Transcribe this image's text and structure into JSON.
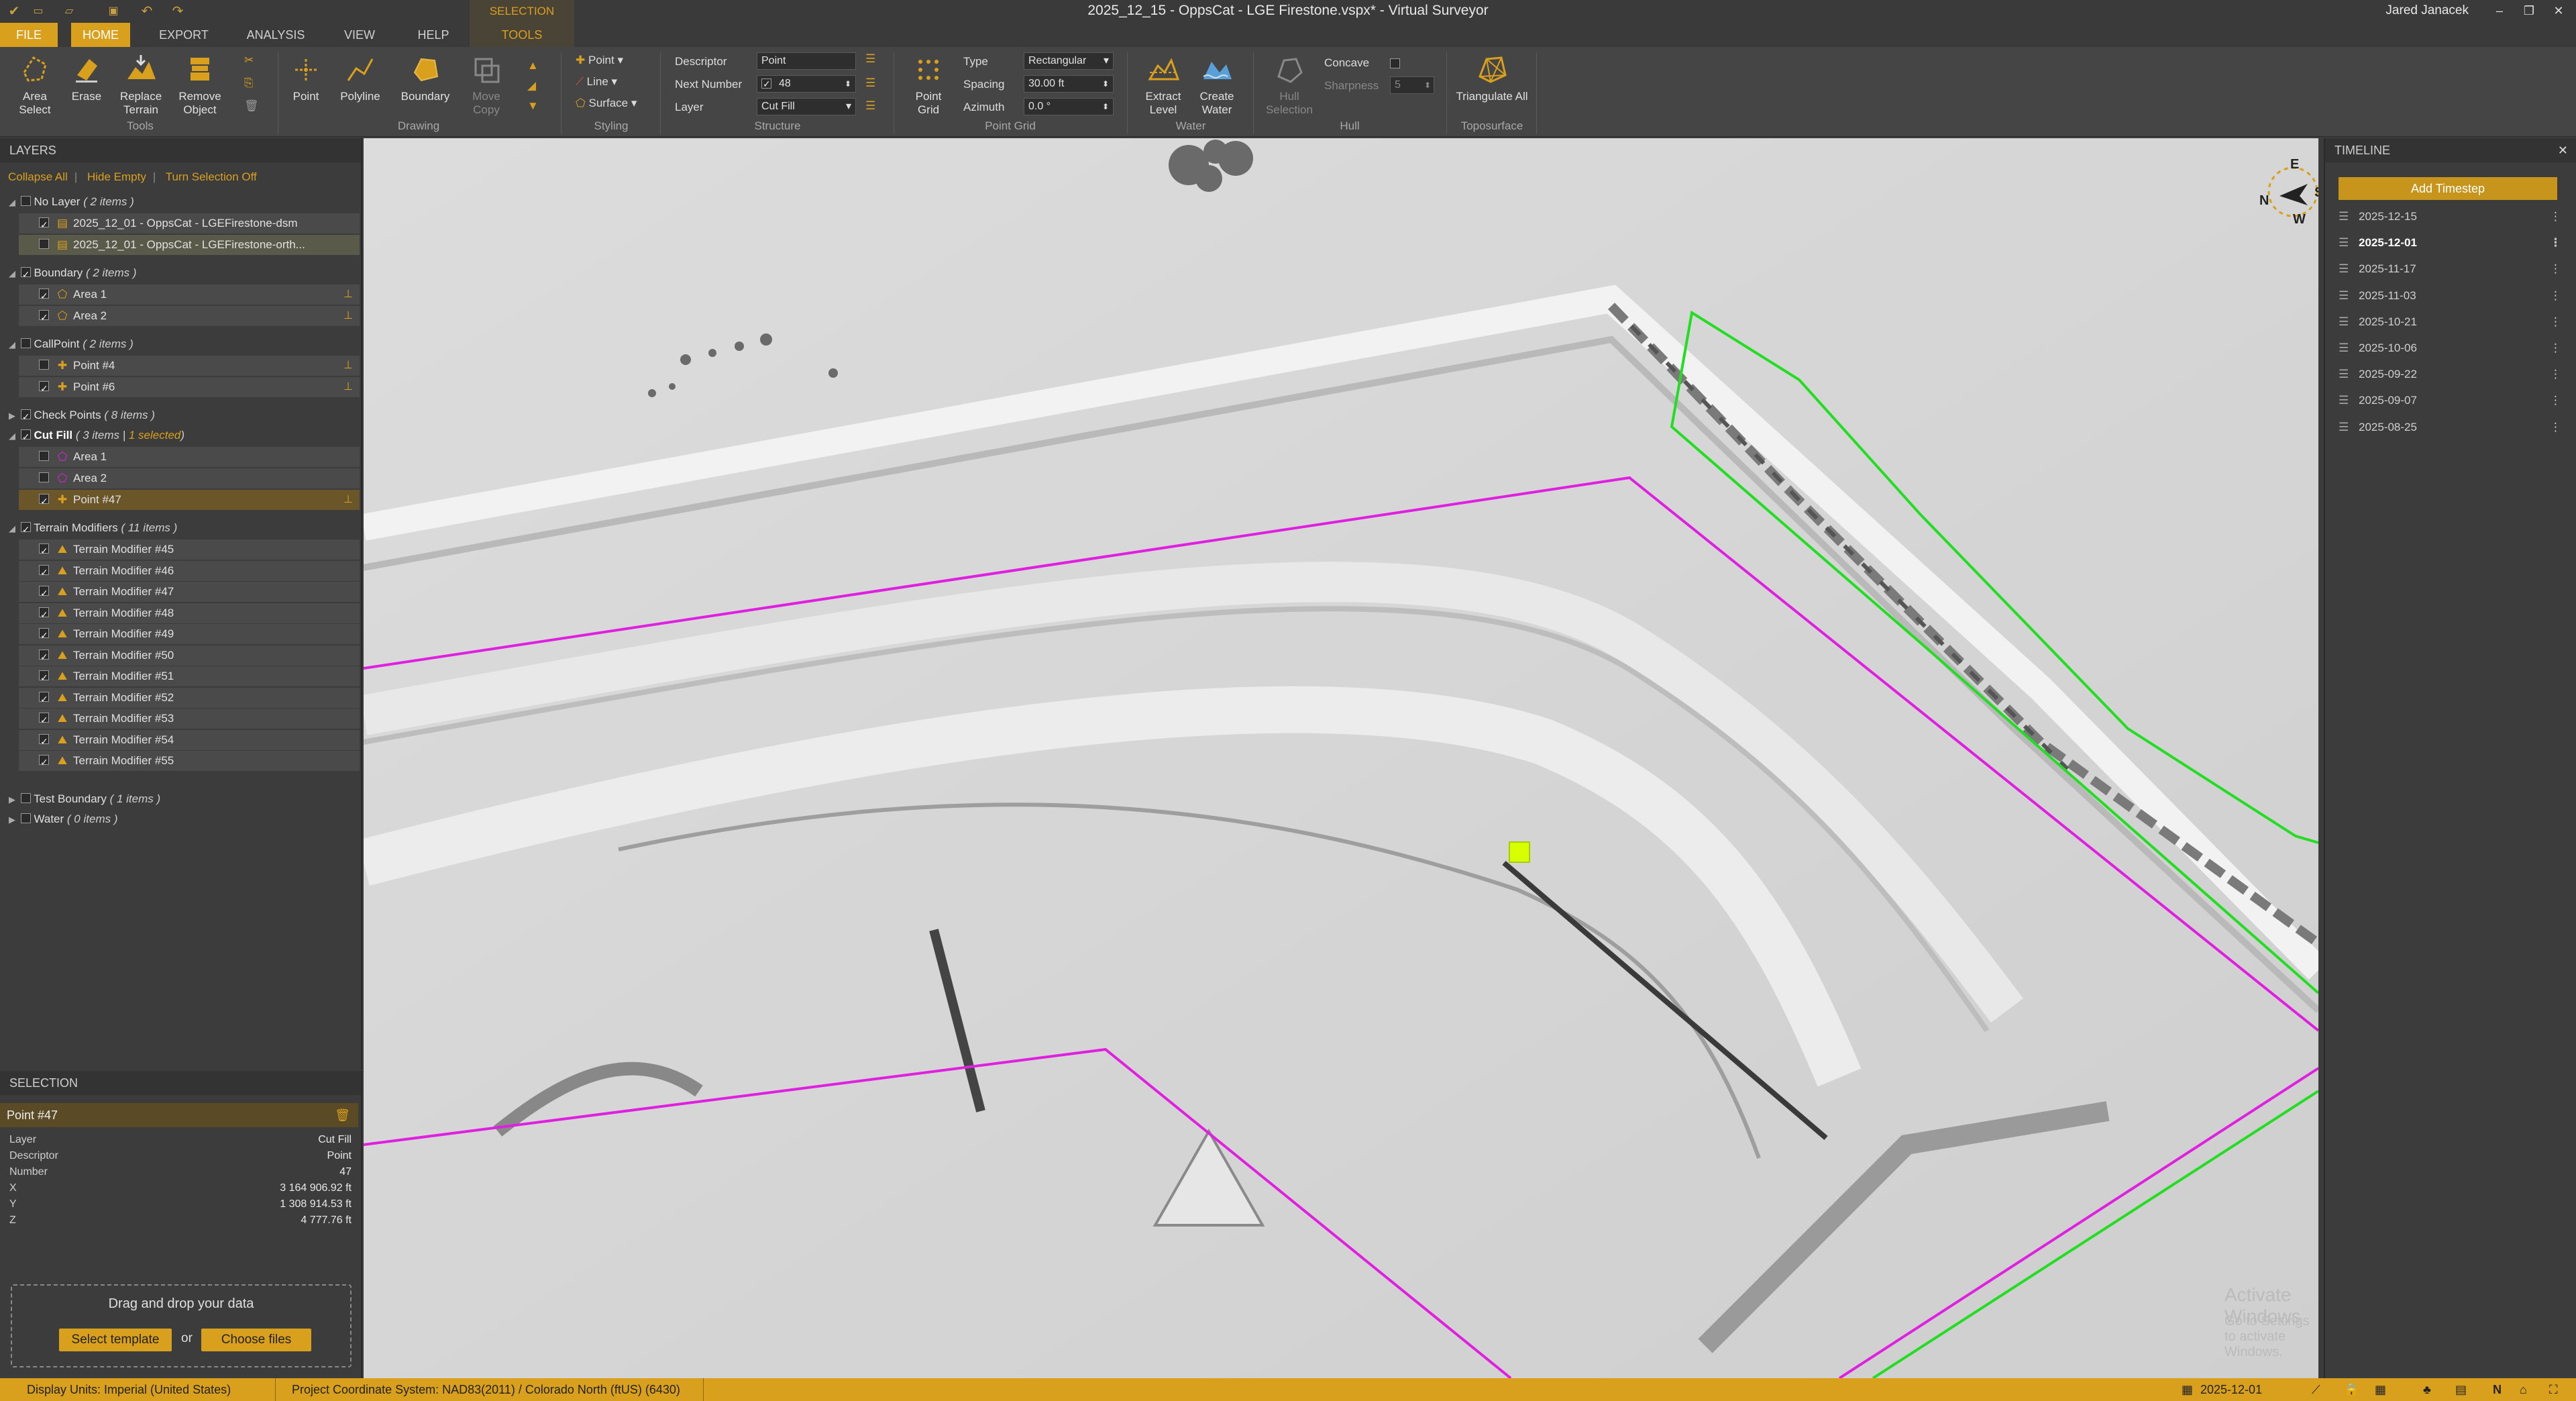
{
  "app": {
    "title": "2025_12_15 - OppsCat - LGE Firestone.vspx* - Virtual Surveyor",
    "user": "Jared Janacek"
  },
  "tabs": {
    "file": "FILE",
    "home": "HOME",
    "export": "EXPORT",
    "analysis": "ANALYSIS",
    "view": "VIEW",
    "help": "HELP",
    "context_group": "SELECTION",
    "tools": "TOOLS"
  },
  "ribbon": {
    "tools": {
      "area_select": "Area Select",
      "erase": "Erase",
      "replace_terrain": "Replace Terrain",
      "remove_object": "Remove Object",
      "group": "Tools"
    },
    "drawing": {
      "point": "Point",
      "polyline": "Polyline",
      "boundary": "Boundary",
      "move_copy": "Move Copy",
      "group": "Drawing"
    },
    "styling": {
      "point": "Point",
      "line": "Line",
      "surface": "Surface",
      "group": "Styling"
    },
    "structure": {
      "descriptor_label": "Descriptor",
      "descriptor_value": "Point",
      "next_number_label": "Next Number",
      "next_number_value": "48",
      "layer_label": "Layer",
      "layer_value": "Cut Fill",
      "group": "Structure"
    },
    "point_grid": {
      "button": "Point Grid",
      "type_label": "Type",
      "type_value": "Rectangular",
      "spacing_label": "Spacing",
      "spacing_value": "30.00 ft",
      "azimuth_label": "Azimuth",
      "azimuth_value": "0.0 °",
      "group": "Point Grid"
    },
    "water": {
      "extract_level": "Extract Level",
      "create_water": "Create Water",
      "group": "Water"
    },
    "hull": {
      "hull_selection": "Hull Selection",
      "concave": "Concave",
      "sharpness_label": "Sharpness",
      "sharpness_value": "5",
      "group": "Hull"
    },
    "toposurface": {
      "triangulate_all": "Triangulate All",
      "group": "Toposurface"
    }
  },
  "layers": {
    "header": "LAYERS",
    "actions": [
      "Collapse All",
      "Hide Empty",
      "Turn Selection Off"
    ],
    "groups": [
      {
        "name": "No Layer",
        "count": "( 2 items )",
        "items": [
          "2025_12_01 - OppsCat - LGEFirestone-dsm",
          "2025_12_01 - OppsCat - LGEFirestone-orth..."
        ]
      },
      {
        "name": "Boundary",
        "count": "( 2 items )",
        "items": [
          "Area 1",
          "Area 2"
        ]
      },
      {
        "name": "CallPoint",
        "count": "( 2 items )",
        "items": [
          "Point #4",
          "Point #6"
        ]
      },
      {
        "name": "Check Points",
        "count": "( 8 items )",
        "items": []
      },
      {
        "name": "Cut Fill",
        "count": "( 3 items |",
        "selected": "1 selected",
        "count_end": ")",
        "items": [
          "Area 1",
          "Area 2",
          "Point #47"
        ]
      },
      {
        "name": "Terrain Modifiers",
        "count": "( 11 items )",
        "items": [
          "Terrain Modifier #45",
          "Terrain Modifier #46",
          "Terrain Modifier #47",
          "Terrain Modifier #48",
          "Terrain Modifier #49",
          "Terrain Modifier #50",
          "Terrain Modifier #51",
          "Terrain Modifier #52",
          "Terrain Modifier #53",
          "Terrain Modifier #54",
          "Terrain Modifier #55"
        ]
      },
      {
        "name": "Test Boundary",
        "count": "( 1 items )",
        "items": []
      },
      {
        "name": "Water",
        "count": "( 0 items )",
        "items": []
      }
    ]
  },
  "selection": {
    "header": "SELECTION",
    "title": "Point #47",
    "props": [
      {
        "k": "Layer",
        "v": "Cut Fill"
      },
      {
        "k": "Descriptor",
        "v": "Point"
      },
      {
        "k": "Number",
        "v": "47"
      },
      {
        "k": "X",
        "v": "3 164 906.92 ft"
      },
      {
        "k": "Y",
        "v": "1 308 914.53 ft"
      },
      {
        "k": "Z",
        "v": "4 777.76 ft"
      }
    ],
    "drop_text": "Drag and drop your data",
    "select_template": "Select template",
    "or": "or",
    "choose_files": "Choose files"
  },
  "map": {
    "watermark_title": "Activate Windows",
    "watermark_sub": "Go to Settings to activate Windows.",
    "compass": {
      "n": "N",
      "e": "E",
      "s": "S",
      "w": "W"
    },
    "colors": {
      "magenta": "#e020e0",
      "green": "#22dd22",
      "marker": "#d8ff00"
    }
  },
  "timeline": {
    "header": "TIMELINE",
    "add": "Add Timestep",
    "items": [
      "2025-12-15",
      "2025-12-01",
      "2025-11-17",
      "2025-11-03",
      "2025-10-21",
      "2025-10-06",
      "2025-09-22",
      "2025-09-07",
      "2025-08-25"
    ],
    "active": "2025-12-01"
  },
  "status": {
    "display_units": "Display Units:  Imperial (United States)",
    "crs": "Project Coordinate System:  NAD83(2011) / Colorado North (ftUS) (6430)",
    "date": "2025-12-01"
  }
}
